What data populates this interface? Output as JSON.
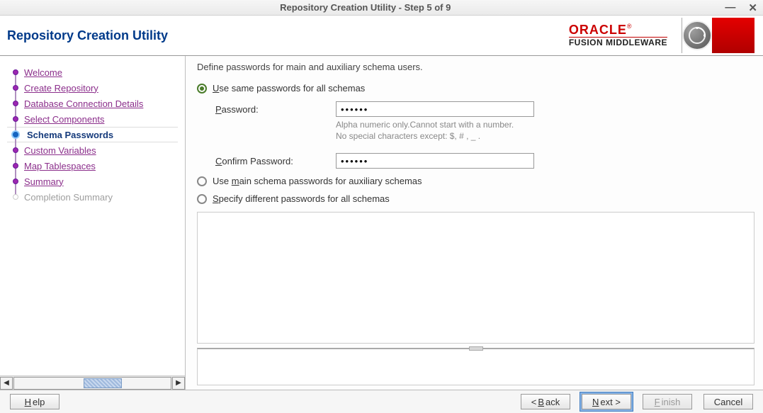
{
  "window": {
    "title": "Repository Creation Utility - Step 5 of 9"
  },
  "header": {
    "title": "Repository Creation Utility",
    "brand": "ORACLE",
    "brand_sub": "FUSION MIDDLEWARE"
  },
  "sidebar": {
    "items": [
      {
        "label": "Welcome"
      },
      {
        "label": "Create Repository"
      },
      {
        "label": "Database Connection Details"
      },
      {
        "label": "Select Components"
      },
      {
        "label": "Schema Passwords"
      },
      {
        "label": "Custom Variables"
      },
      {
        "label": "Map Tablespaces"
      },
      {
        "label": "Summary"
      },
      {
        "label": "Completion Summary"
      }
    ]
  },
  "content": {
    "instruction": "Define passwords for main and auxiliary schema users.",
    "options": {
      "same": "Use same passwords for all schemas",
      "main": "Use main schema passwords for auxiliary schemas",
      "specify": "Specify different passwords for all schemas"
    },
    "password_label": "Password:",
    "confirm_label": "Confirm Password:",
    "password_value": "••••••",
    "confirm_value": "••••••",
    "hint_line1": "Alpha numeric only.Cannot start with a number.",
    "hint_line2": "No special characters except: $, # , _ ."
  },
  "footer": {
    "help": "Help",
    "back": "< Back",
    "next": "Next >",
    "finish": "Finish",
    "cancel": "Cancel"
  }
}
